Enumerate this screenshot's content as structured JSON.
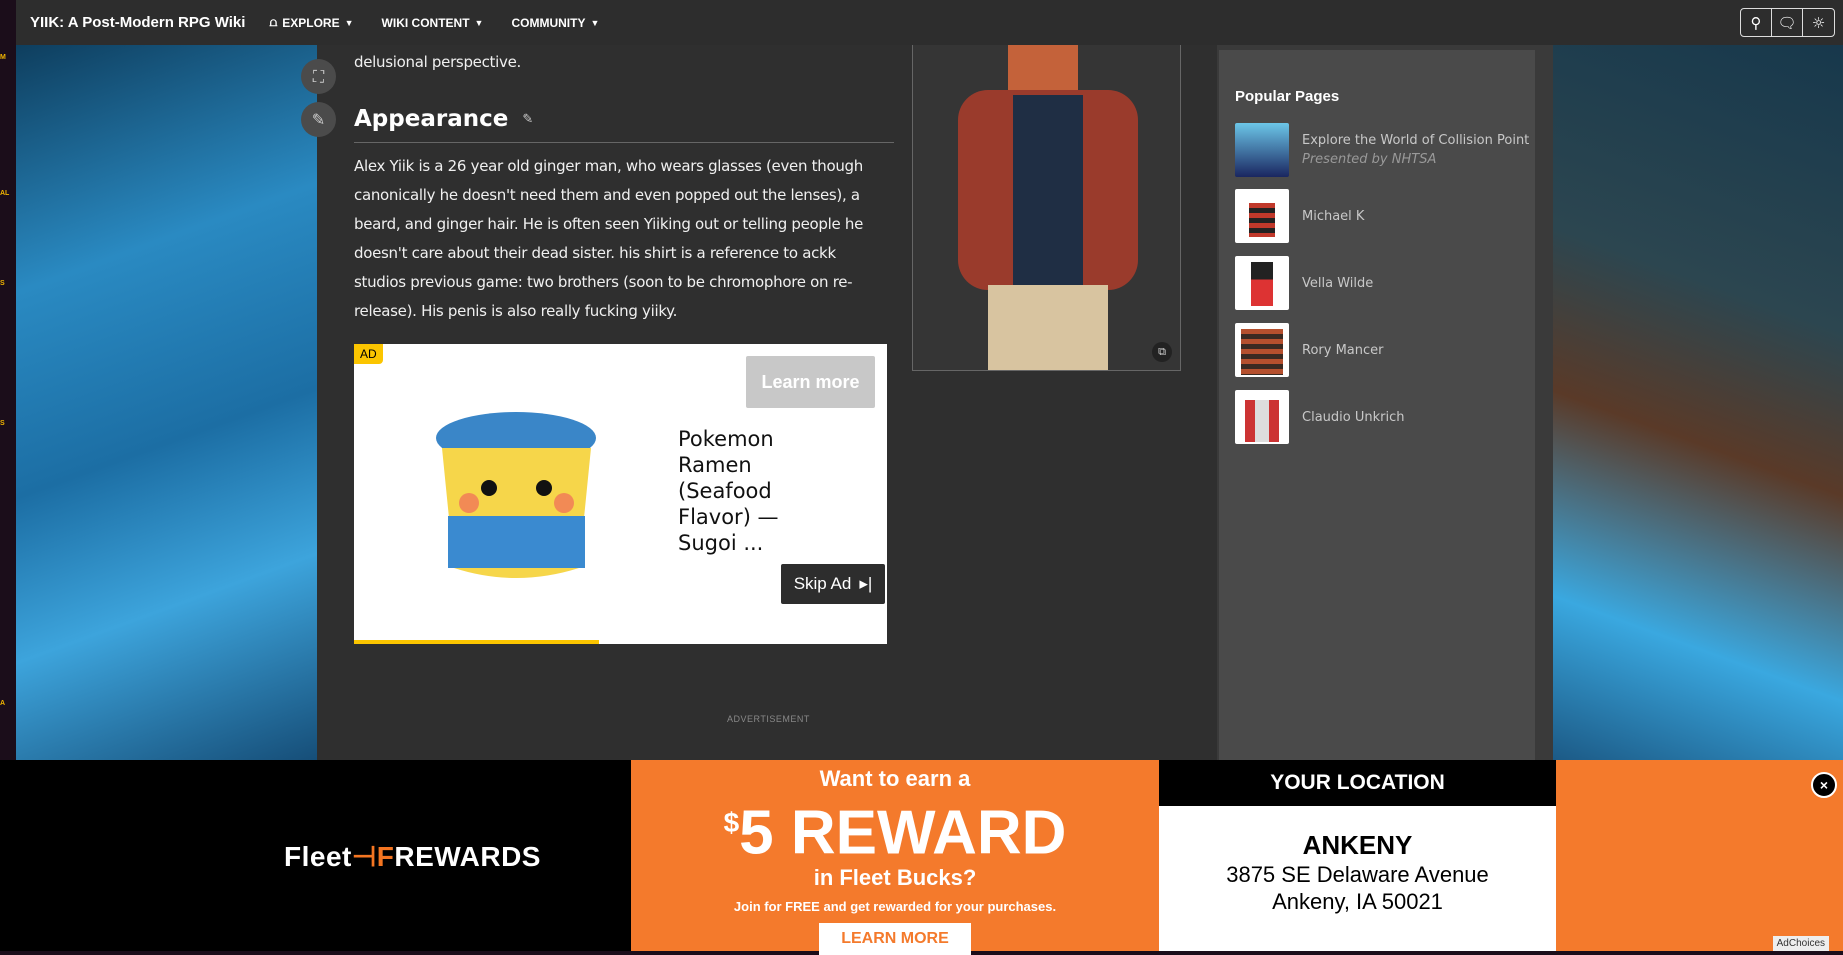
{
  "header": {
    "title": "YIIK: A Post-Modern RPG Wiki",
    "nav": [
      "EXPLORE",
      "WIKI CONTENT",
      "COMMUNITY"
    ],
    "tools": [
      "search-icon",
      "discussions-icon",
      "theme-icon"
    ]
  },
  "article": {
    "intro_tail": "delusional perspective.",
    "section_title": "Appearance",
    "paragraph_lines": [
      "Alex Yiik is a 26 year old ginger man, who wears glasses (even though",
      "canonically he doesn't need them and even popped out the lenses), a",
      "beard, and ginger hair. He is often seen Yiiking out or telling people he",
      "doesn't care about their dead sister. his shirt is a reference to ackk",
      "studios previous game: two brothers (soon to be chromophore on re-",
      "release). His penis is also really fucking yiiky."
    ]
  },
  "video_ad": {
    "tag": "AD",
    "learn_more": "Learn more",
    "title": "Pokemon Ramen (Seafood Flavor) — Sugoi ...",
    "skip": "Skip Ad",
    "progress_percent": 46
  },
  "advertisement_label": "ADVERTISEMENT",
  "popular": {
    "title": "Popular Pages",
    "items": [
      {
        "label": "Explore the World of Collision Point",
        "sub": "Presented by NHTSA"
      },
      {
        "label": "Michael K"
      },
      {
        "label": "Vella Wilde"
      },
      {
        "label": "Rory Mancer"
      },
      {
        "label": "Claudio Unkrich"
      }
    ]
  },
  "banner": {
    "brand_a": "Fleet",
    "brand_b": "REWARDS",
    "line1": "Want to earn a",
    "dollar": "$",
    "amount": "5 REWARD",
    "line3": "in Fleet Bucks?",
    "line4": "Join for FREE and get rewarded for your purchases.",
    "cta": "LEARN MORE",
    "loc_header": "YOUR LOCATION",
    "city": "ANKENY",
    "address1": "3875 SE Delaware Avenue",
    "address2": "Ankeny, IA 50021",
    "adchoices": "AdChoices",
    "close": "×"
  },
  "colors": {
    "accent": "#f47a2c",
    "ad_yellow": "#fbc500"
  }
}
